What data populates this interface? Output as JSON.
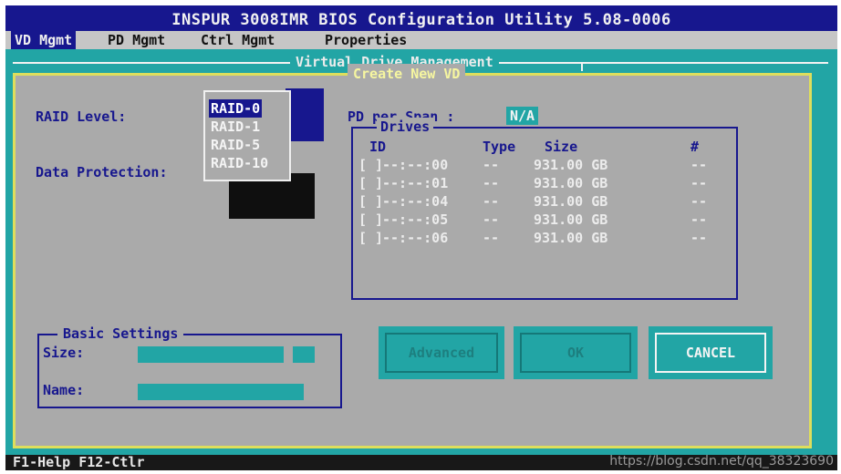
{
  "window": {
    "title": "INSPUR 3008IMR BIOS Configuration Utility 5.08-0006"
  },
  "menu": [
    {
      "label": "VD Mgmt",
      "active": true
    },
    {
      "label": "PD Mgmt",
      "active": false
    },
    {
      "label": "Ctrl Mgmt",
      "active": false
    },
    {
      "label": "Properties",
      "active": false
    }
  ],
  "panel": {
    "title": "Virtual Drive Management"
  },
  "dialog": {
    "title": "Create New VD",
    "raid_level_label": "RAID Level:",
    "data_protection_label": "Data Protection:",
    "raid_options": [
      "RAID-0",
      "RAID-1",
      "RAID-5",
      "RAID-10"
    ],
    "raid_selected": "RAID-0",
    "pd_per_span_label": "PD per Span :",
    "pd_per_span_value": "N/A"
  },
  "drives": {
    "title": "Drives",
    "columns": {
      "id": "ID",
      "type": "Type",
      "size": "Size",
      "count": "#"
    },
    "rows": [
      {
        "check": "[ ]",
        "id": "--:--:00",
        "type": "--",
        "size": "931.00 GB",
        "count": "--"
      },
      {
        "check": "[ ]",
        "id": "--:--:01",
        "type": "--",
        "size": "931.00 GB",
        "count": "--"
      },
      {
        "check": "[ ]",
        "id": "--:--:04",
        "type": "--",
        "size": "931.00 GB",
        "count": "--"
      },
      {
        "check": "[ ]",
        "id": "--:--:05",
        "type": "--",
        "size": "931.00 GB",
        "count": "--"
      },
      {
        "check": "[ ]",
        "id": "--:--:06",
        "type": "--",
        "size": "931.00 GB",
        "count": "--"
      }
    ]
  },
  "basic_settings": {
    "title": "Basic Settings",
    "size_label": "Size:",
    "name_label": "Name:",
    "size_value": "",
    "name_value": ""
  },
  "buttons": {
    "advanced": "Advanced",
    "ok": "OK",
    "cancel": "CANCEL"
  },
  "help_bar": {
    "f1": "F1",
    "text": "-Help F12-Ctlr"
  },
  "watermark": "https://blog.csdn.net/qq_38323690",
  "colors": {
    "bios_blue": "#17178e",
    "cyan": "#22a5a5",
    "gray": "#aaaaaa",
    "yellow_border": "#dede5c"
  }
}
